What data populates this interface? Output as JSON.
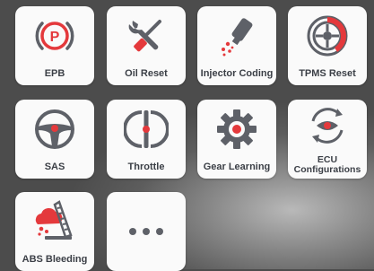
{
  "colors": {
    "icon_gray": "#5e6168",
    "accent_red": "#e4393c",
    "tile_bg": "#fafafa",
    "label": "#3b3f46"
  },
  "functions": [
    {
      "label": "EPB",
      "icon": "parking-brake-icon"
    },
    {
      "label": "Oil Reset",
      "icon": "wrench-screwdriver-icon"
    },
    {
      "label": "Injector Coding",
      "icon": "injector-icon"
    },
    {
      "label": "TPMS Reset",
      "icon": "tire-icon"
    },
    {
      "label": "SAS",
      "icon": "steering-wheel-icon"
    },
    {
      "label": "Throttle",
      "icon": "throttle-icon"
    },
    {
      "label": "Gear Learning",
      "icon": "gear-icon"
    },
    {
      "label": "ECU\nConfigurations",
      "icon": "ecu-eye-icon"
    },
    {
      "label": "ABS Bleeding",
      "icon": "abs-bleeding-icon"
    },
    {
      "label": "",
      "icon": "more-icon"
    }
  ]
}
